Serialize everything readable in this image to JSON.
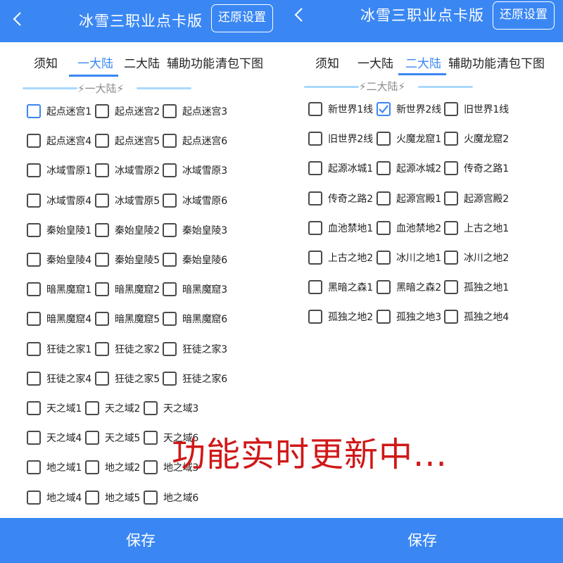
{
  "left": {
    "title": "冰雪三职业点卡版",
    "reset_label": "还原设置",
    "tabs": [
      "须知",
      "一大陆",
      "二大陆",
      "辅助功能",
      "清包下图"
    ],
    "active_tab": 1,
    "section_title": "⚡一大陆⚡",
    "items": [
      "起点迷宫1",
      "起点迷宫2",
      "起点迷宫3",
      "起点迷宫4",
      "起点迷宫5",
      "起点迷宫6",
      "冰域雪原1",
      "冰域雪原2",
      "冰域雪原3",
      "冰域雪原4",
      "冰域雪原5",
      "冰域雪原6",
      "秦始皇陵1",
      "秦始皇陵2",
      "秦始皇陵3",
      "秦始皇陵4",
      "秦始皇陵5",
      "秦始皇陵6",
      "暗黑魔窟1",
      "暗黑魔窟2",
      "暗黑魔窟3",
      "暗黑魔窟4",
      "暗黑魔窟5",
      "暗黑魔窟6",
      "狂徒之家1",
      "狂徒之家2",
      "狂徒之家3",
      "狂徒之家4",
      "狂徒之家5",
      "狂徒之家6",
      "天之域1",
      "天之域2",
      "天之域3",
      "天之域4",
      "天之域5",
      "天之域6",
      "地之域1",
      "地之域2",
      "地之域3",
      "地之域4",
      "地之域5",
      "地之域6"
    ],
    "checked": [],
    "save_label": "保存"
  },
  "right": {
    "title": "冰雪三职业点卡版",
    "reset_label": "还原设置",
    "tabs": [
      "须知",
      "一大陆",
      "二大陆",
      "辅助功能",
      "清包下图"
    ],
    "active_tab": 2,
    "section_title": "⚡二大陆⚡",
    "items": [
      "新世界1线",
      "新世界2线",
      "旧世界1线",
      "旧世界2线",
      "火魔龙窟1",
      "火魔龙窟2",
      "起源冰城1",
      "起源冰城2",
      "传奇之路1",
      "传奇之路2",
      "起源宫殿1",
      "起源宫殿2",
      "血池禁地1",
      "血池禁地2",
      "上古之地1",
      "上古之地2",
      "冰川之地1",
      "冰川之地2",
      "黑暗之森1",
      "黑暗之森2",
      "孤独之地1",
      "孤独之地2",
      "孤独之地3",
      "孤独之地4"
    ],
    "checked": [
      "新世界2线"
    ],
    "save_label": "保存"
  },
  "overlay_text": "功能实时更新中...",
  "colors": {
    "primary": "#3a87f4",
    "overlay_red": "#d01818",
    "section_dash": "#a9d9ff"
  },
  "icons": {
    "back": "chevron-left-icon",
    "check": "checkmark-icon",
    "section_decor": "lightning-emoji"
  }
}
